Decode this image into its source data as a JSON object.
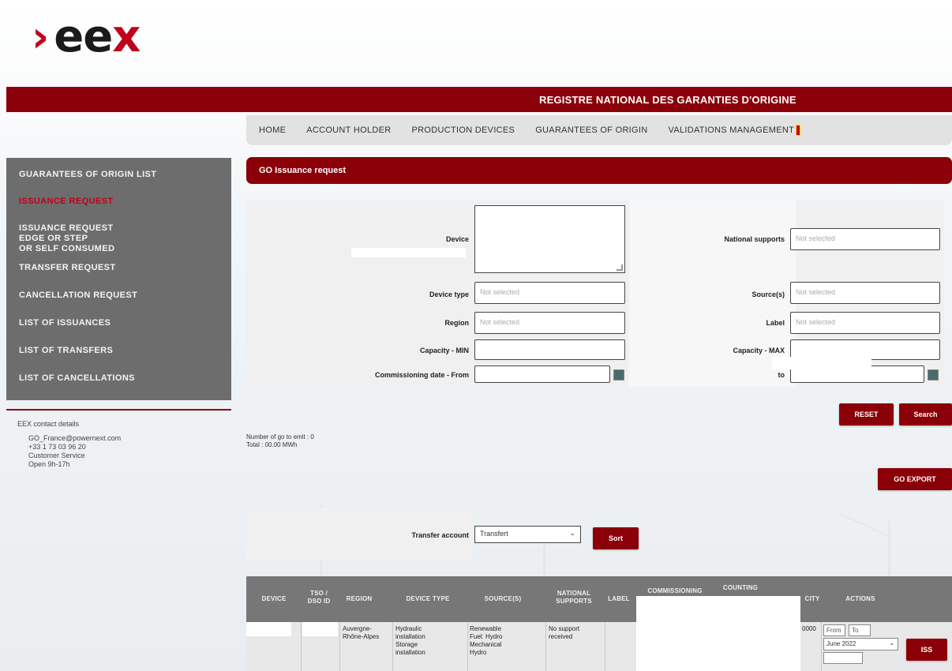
{
  "logo": {
    "chevron": "›",
    "ee": "ee",
    "x": "x"
  },
  "registry_title": "REGISTRE NATIONAL DES GARANTIES D'ORIGINE",
  "nav": [
    "HOME",
    "ACCOUNT HOLDER",
    "PRODUCTION DEVICES",
    "GUARANTEES OF ORIGIN",
    "VALIDATIONS MANAGEMENT"
  ],
  "sidebar": {
    "items": [
      {
        "label": "GUARANTEES OF ORIGIN LIST"
      },
      {
        "label": "ISSUANCE REQUEST"
      },
      {
        "label1": "ISSUANCE REQUEST",
        "label2": "EDGE OR STEP",
        "label3": "OR SELF CONSUMED"
      },
      {
        "label": "TRANSFER REQUEST"
      },
      {
        "label": "CANCELLATION REQUEST"
      },
      {
        "label": "LIST OF ISSUANCES"
      },
      {
        "label": "LIST OF TRANSFERS"
      },
      {
        "label": "LIST OF CANCELLATIONS"
      }
    ]
  },
  "contact": {
    "heading": "EEX contact details",
    "lines": [
      "GO_France@powernext.com",
      "+33 1 73 03 96 20",
      "Customer Service",
      "Open 9h-17h"
    ]
  },
  "section_title": "GO Issuance request",
  "form": {
    "device_label": "Device",
    "device_type_label": "Device type",
    "device_type_placeholder": "Not selected",
    "region_label": "Region",
    "region_placeholder": "Not selected",
    "capacity_min_label": "Capacity - MIN",
    "commissioning_label": "Commissioning date - From",
    "national_supports_label": "National supports",
    "national_supports_placeholder": "Not selected",
    "sources_label": "Source(s)",
    "sources_placeholder": "Not selected",
    "label_label": "Label",
    "label_placeholder": "Not selected",
    "capacity_max_label": "Capacity - MAX",
    "to_label": "to"
  },
  "buttons": {
    "reset": "RESET",
    "search": "Search",
    "go_export": "GO EXPORT",
    "sort": "Sort",
    "row_action": "ISS"
  },
  "info": {
    "line1": "Number of go to emit : 0",
    "line2": "Total : 00.00 MWh"
  },
  "transfer": {
    "label": "Transfer account",
    "value": "Transfert",
    "arrow": "⌄"
  },
  "table": {
    "headers": [
      {
        "h1": "DEVICE",
        "h2": ""
      },
      {
        "h1": "TSO /",
        "h2": "DSO ID"
      },
      {
        "h1": "REGION",
        "h2": ""
      },
      {
        "h1": "DEVICE TYPE",
        "h2": ""
      },
      {
        "h1": "SOURCE(S)",
        "h2": ""
      },
      {
        "h1": "NATIONAL",
        "h2": "SUPPORTS"
      },
      {
        "h1": "LABEL",
        "h2": ""
      },
      {
        "h1": "COMMISSIONING",
        "h2": ""
      },
      {
        "h1": "COUNTING",
        "h2": ""
      },
      {
        "h1": "CITY",
        "h2": ""
      },
      {
        "h1": "ACTIONS",
        "h2": ""
      }
    ],
    "row": {
      "region": "Auvergne-Rhône-Alpes",
      "device_type1": "Hydraulic",
      "device_type2": "installation",
      "device_type3": "Storage",
      "device_type4": "installation",
      "source1": "Renewable",
      "source2": "Fuel: Hydro",
      "source3": "Mechanical",
      "source4": "Hydro",
      "national1": "No support",
      "national2": "received",
      "from": "From",
      "to": "To",
      "month": "June 2022",
      "month_arrow": "⌄",
      "counter": "0000"
    }
  }
}
